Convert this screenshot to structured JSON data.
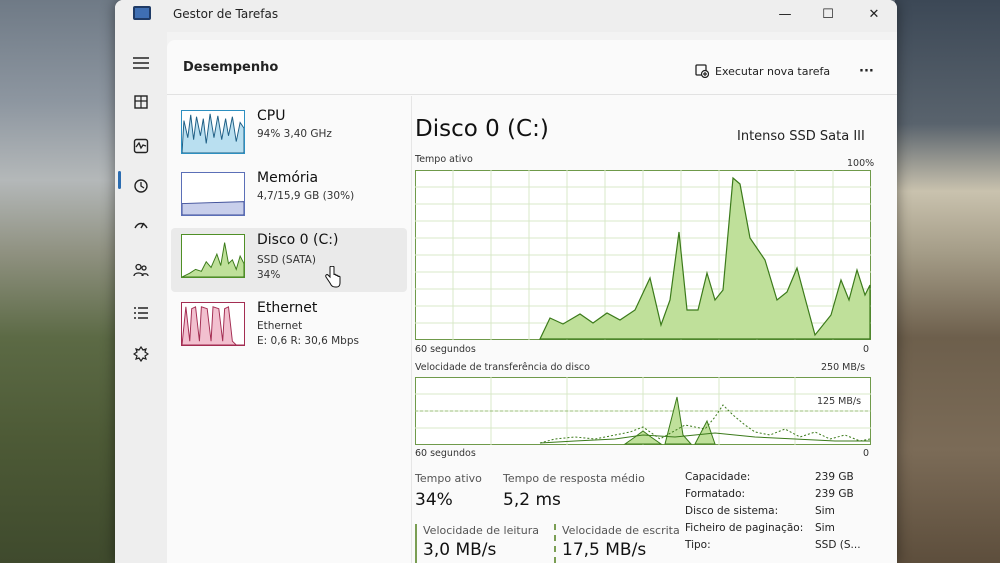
{
  "window": {
    "title": "Gestor de Tarefas",
    "controls": [
      "—",
      "☐",
      "✕"
    ]
  },
  "nav": {
    "items": [
      "hamburger-icon",
      "processes-icon",
      "performance-icon",
      "history-icon",
      "startup-icon",
      "users-icon",
      "details-icon",
      "services-icon"
    ]
  },
  "header": {
    "title": "Desempenho",
    "run_task_label": "Executar nova tarefa",
    "more_label": "···"
  },
  "perf_list": [
    {
      "name": "CPU",
      "sub1": "94% 3,40 GHz",
      "sub2": "",
      "sub3": "",
      "color": "#2d8fc0",
      "fill": "#b9dff0"
    },
    {
      "name": "Memória",
      "sub1": "4,7/15,9 GB (30%)",
      "sub2": "",
      "sub3": "",
      "color": "#5b6fb7",
      "fill": "#c8cfeb"
    },
    {
      "name": "Disco 0 (C:)",
      "sub1": "SSD (SATA)",
      "sub2": "34%",
      "sub3": "",
      "color": "#4f8f26",
      "fill": "#bfe09a"
    },
    {
      "name": "Ethernet",
      "sub1": "Ethernet",
      "sub2": "E: 0,6 R: 30,6 Mbps",
      "sub3": "",
      "color": "#a32d52",
      "fill": "#f2c0cf"
    }
  ],
  "detail": {
    "title": "Disco 0 (C:)",
    "model": "Intenso SSD Sata III",
    "chart1": {
      "label": "Tempo ativo",
      "max_label": "100%",
      "time_label": "60 segundos",
      "zero_label": "0"
    },
    "chart2": {
      "label": "Velocidade de transferência do disco",
      "max_label": "250 MB/s",
      "mid_label": "125 MB/s",
      "time_label": "60 segundos",
      "zero_label": "0"
    },
    "stats": {
      "active_time_label": "Tempo ativo",
      "active_time_value": "34%",
      "response_label": "Tempo de resposta médio",
      "response_value": "5,2 ms",
      "read_label": "Velocidade de leitura",
      "read_value": "3,0 MB/s",
      "write_label": "Velocidade de escrita",
      "write_value": "17,5 MB/s"
    },
    "info": [
      {
        "label": "Capacidade:",
        "value": "239 GB"
      },
      {
        "label": "Formatado:",
        "value": "239 GB"
      },
      {
        "label": "Disco de sistema:",
        "value": "Sim"
      },
      {
        "label": "Ficheiro de paginação:",
        "value": "Sim"
      },
      {
        "label": "Tipo:",
        "value": "SSD (S..."
      }
    ]
  },
  "colors": {
    "disk_line": "#4f8f26",
    "disk_fill": "#bfe09a",
    "grid": "#d8e8c8"
  }
}
